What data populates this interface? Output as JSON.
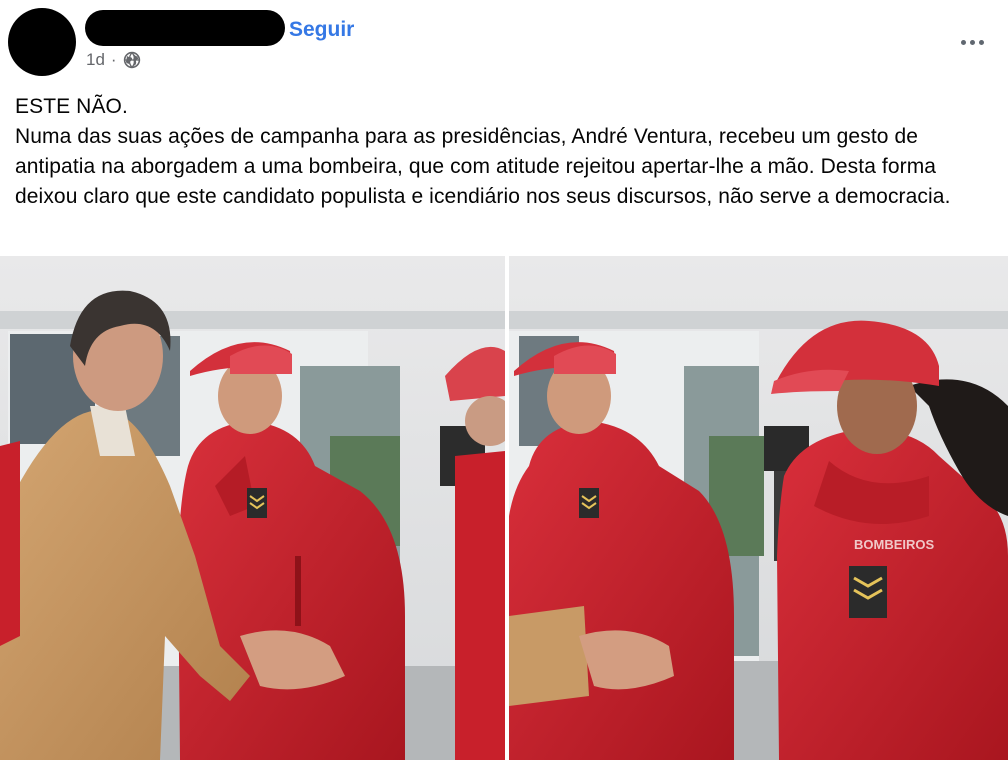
{
  "post": {
    "follow_label": "Seguir",
    "time": "1d",
    "separator": "·",
    "privacy_icon": "globe-icon",
    "more_icon": "more-options-icon",
    "text_line1": "ESTE NÃO.",
    "text_body": "Numa das suas ações de campanha para as presidências, André Ventura, recebeu um gesto de antipatia na aborgadem a uma bombeira, que com atitude rejeitou apertar-lhe a mão. Desta forma deixou claro que este candidato populista e icendiário nos seus discursos, não serve a democracia."
  },
  "photos": {
    "jacket_badge": "BOMBEIROS"
  },
  "colors": {
    "link_blue": "#3578e5",
    "meta_grey": "#65676b",
    "jacket_red": "#c8202b"
  }
}
